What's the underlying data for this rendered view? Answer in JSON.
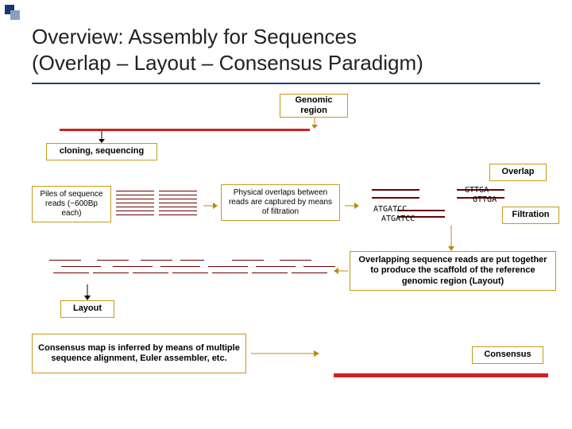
{
  "title_line1": "Overview: Assembly for Sequences",
  "title_line2": "(Overlap – Layout – Consensus Paradigm)",
  "genomic_region": "Genomic region",
  "cloning": "cloning, sequencing",
  "piles": "Piles of sequence reads (~600Bp each)",
  "overlap_desc": "Physical overlaps between reads are captured by means of filtration",
  "phase_overlap": "Overlap",
  "phase_filtration": "Filtration",
  "layout_desc": "Overlapping sequence reads are put together to produce the scaffold of the reference genomic region (Layout)",
  "phase_layout": "Layout",
  "consensus_desc": "Consensus map is inferred by means of multiple sequence alignment, Euler assembler, etc.",
  "phase_consensus": "Consensus",
  "seq_a1": "ATGATCC",
  "seq_a2": "ATGATCC",
  "seq_b1": "GTTGA",
  "seq_b2": "GTTGA"
}
